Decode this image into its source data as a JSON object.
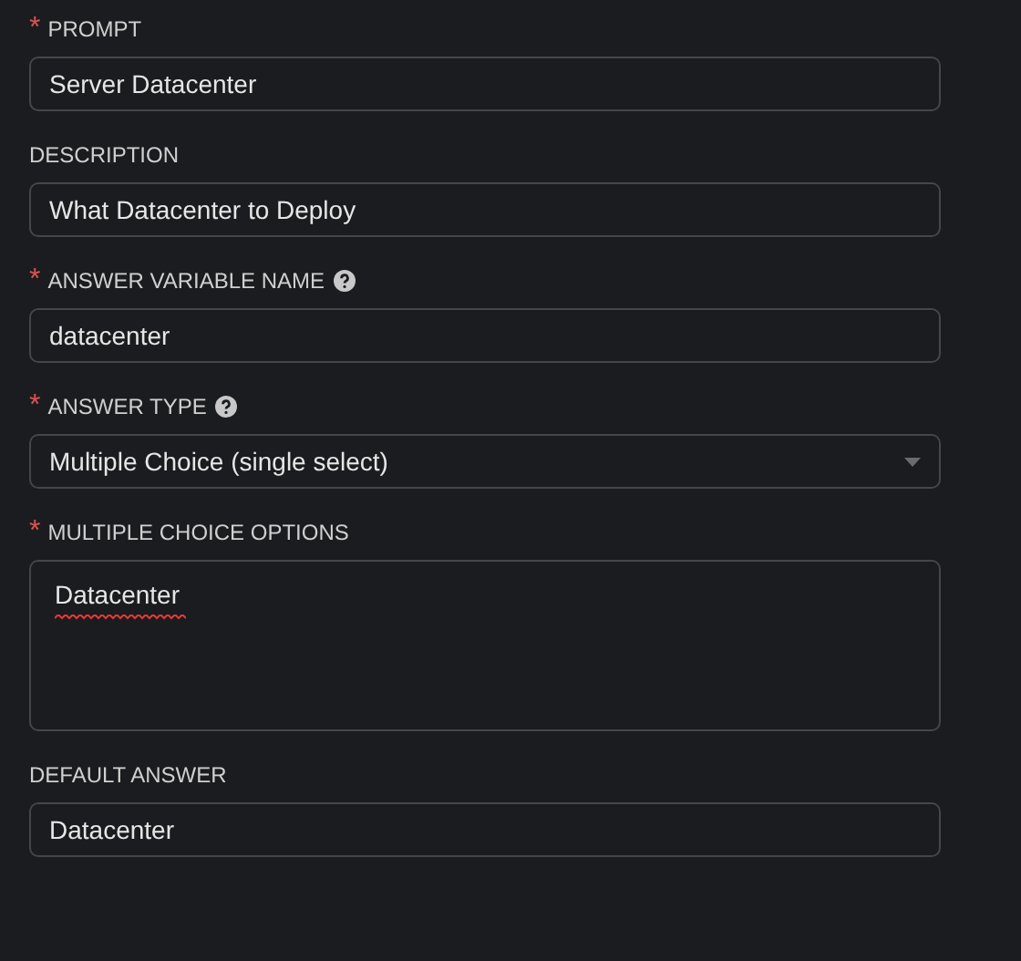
{
  "fields": [
    {
      "label": "PROMPT",
      "required_mark": "*",
      "help": false,
      "kind": "text",
      "value": "Server Datacenter"
    },
    {
      "label": "DESCRIPTION",
      "help": false,
      "kind": "text",
      "value": "What Datacenter to Deploy"
    },
    {
      "label": "ANSWER VARIABLE NAME",
      "required_mark": "*",
      "help": true,
      "kind": "text",
      "value": "datacenter"
    },
    {
      "label": "ANSWER TYPE",
      "required_mark": "*",
      "help": true,
      "kind": "select",
      "value": "Multiple Choice (single select)"
    },
    {
      "label": "MULTIPLE CHOICE OPTIONS",
      "required_mark": "*",
      "help": false,
      "kind": "textarea",
      "value": "Datacenter",
      "misspelled": true
    },
    {
      "label": "DEFAULT ANSWER",
      "help": false,
      "kind": "text",
      "value": "Datacenter"
    }
  ]
}
